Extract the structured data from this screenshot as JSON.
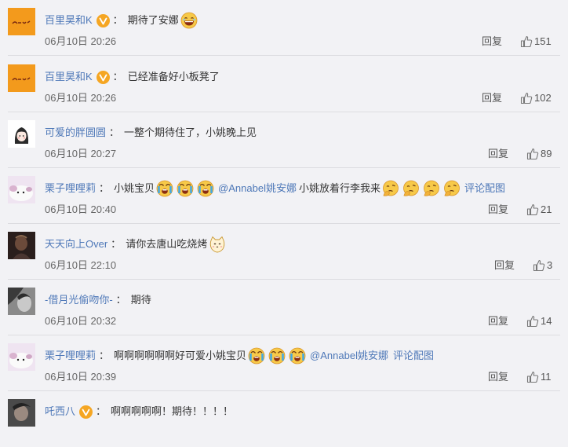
{
  "comments": [
    {
      "user": "百里昊和K",
      "verified": true,
      "text": "期待了安娜",
      "time": "06月10日 20:26",
      "reply": "回复",
      "likes": "151"
    },
    {
      "user": "百里昊和K",
      "verified": true,
      "text": "已经准备好小板凳了",
      "time": "06月10日 20:26",
      "reply": "回复",
      "likes": "102"
    },
    {
      "user": "可爱的胖圆圆",
      "verified": false,
      "text": "一整个期待住了，小姚晚上见",
      "time": "06月10日 20:27",
      "reply": "回复",
      "likes": "89"
    },
    {
      "user": "栗子哩哩莉",
      "verified": false,
      "text_a": "小姚宝贝",
      "mention": "@Annabel姚安娜",
      "text_b": "小姚放着行李我来",
      "piclink": "评论配图",
      "time": "06月10日 20:40",
      "reply": "回复",
      "likes": "21"
    },
    {
      "user": "天天向上Over",
      "verified": false,
      "text": "请你去唐山吃烧烤",
      "time": "06月10日 22:10",
      "reply": "回复",
      "likes": "3"
    },
    {
      "user": "-借月光偷吻你-",
      "verified": false,
      "text": "期待",
      "time": "06月10日 20:32",
      "reply": "回复",
      "likes": "14"
    },
    {
      "user": "栗子哩哩莉",
      "verified": false,
      "text": "啊啊啊啊啊啊好可爱小姚宝贝",
      "mention": "@Annabel姚安娜",
      "piclink": "评论配图",
      "time": "06月10日 20:39",
      "reply": "回复",
      "likes": "11"
    },
    {
      "user": "吒西八",
      "verified": true,
      "text": "啊啊啊啊啊！期待！！！！"
    }
  ],
  "separator": "：",
  "colors": {
    "link": "#4e78b8",
    "background": "#f2f2f5",
    "badge": "#f5a623"
  }
}
